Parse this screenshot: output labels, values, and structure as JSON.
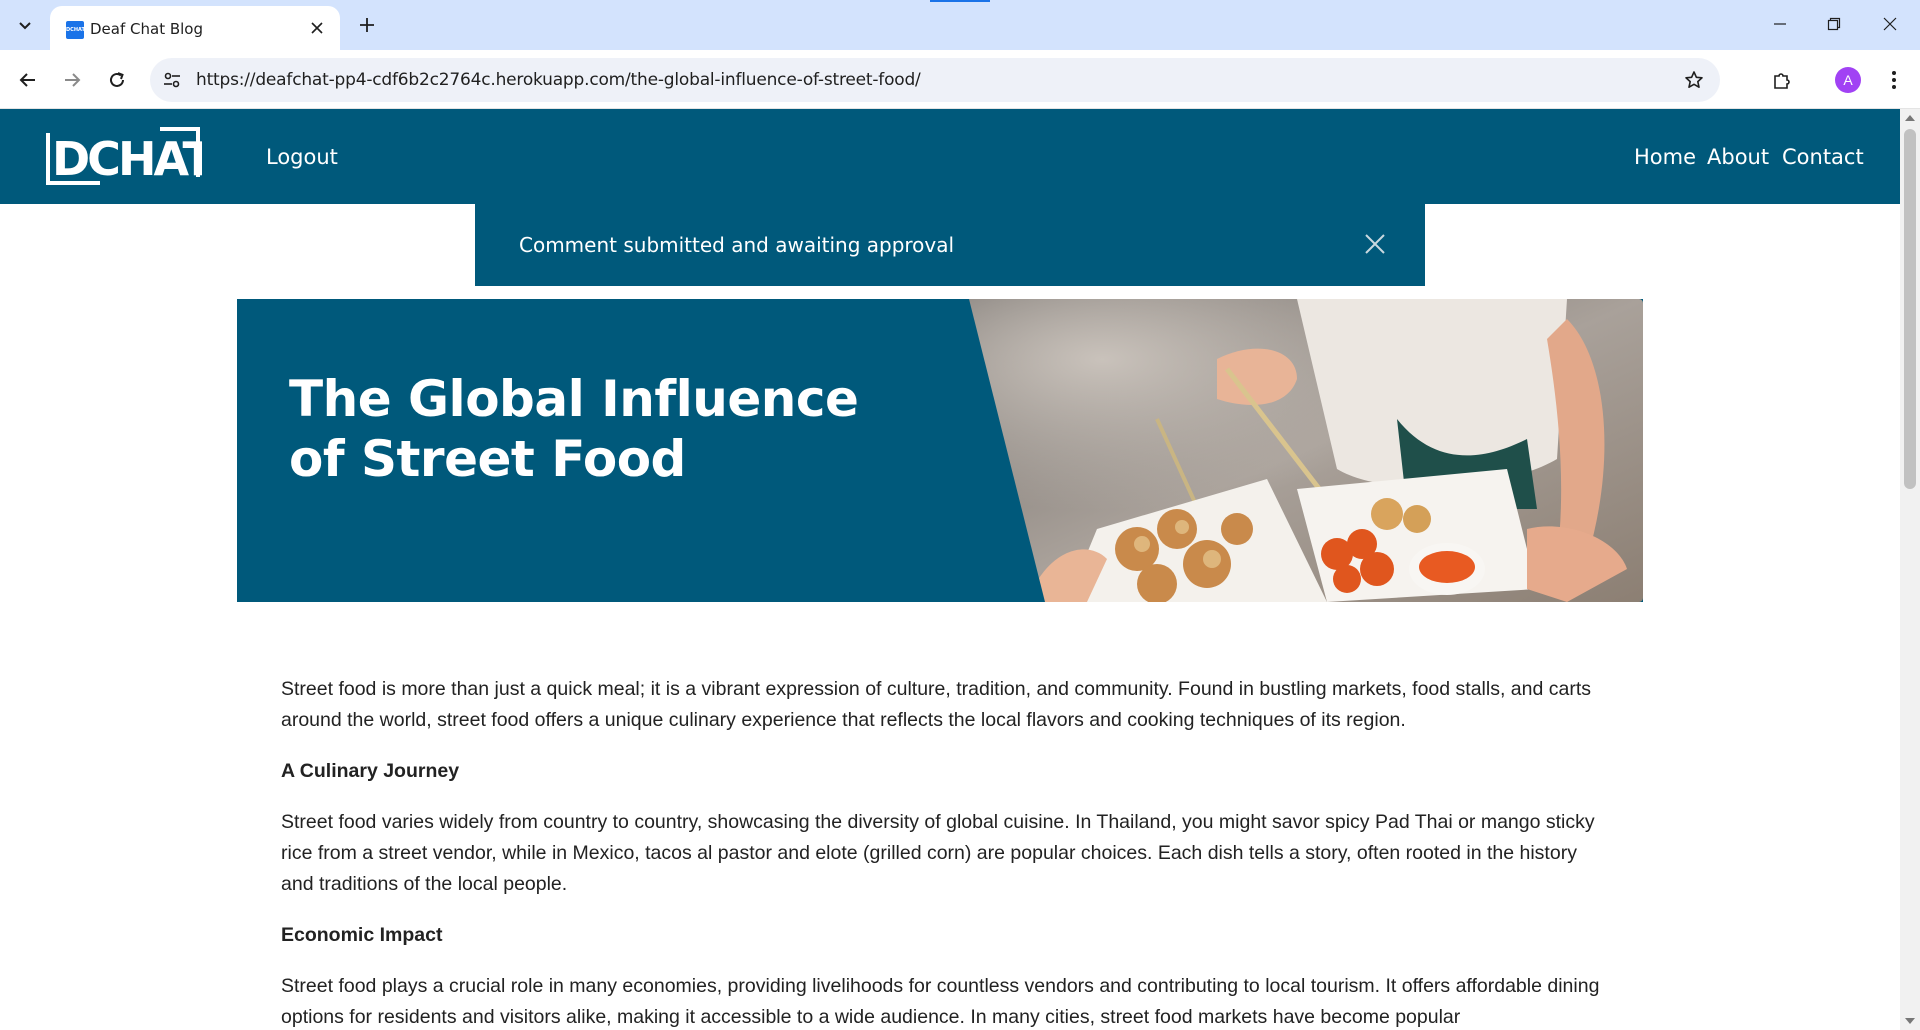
{
  "browser": {
    "tab_title": "Deaf Chat Blog",
    "favicon_text": "DCHAT",
    "url": "https://deafchat-pp4-cdf6b2c2764c.herokuapp.com/the-global-influence-of-street-food/",
    "profile_initial": "A"
  },
  "site": {
    "logo_text": "DCHAT",
    "logout": "Logout",
    "nav": {
      "home": "Home",
      "about": "About",
      "contact": "Contact"
    },
    "colors": {
      "primary": "#00597b"
    }
  },
  "alert": {
    "message": "Comment submitted and awaiting approval"
  },
  "post": {
    "title": "The Global Influence of Street Food",
    "paragraphs": [
      "Street food is more than just a quick meal; it is a vibrant expression of culture, tradition, and community. Found in bustling markets, food stalls, and carts around the world, street food offers a unique culinary experience that reflects the local flavors and cooking techniques of its region."
    ],
    "sections": [
      {
        "heading": "A Culinary Journey",
        "text": "Street food varies widely from country to country, showcasing the diversity of global cuisine. In Thailand, you might savor spicy Pad Thai or mango sticky rice from a street vendor, while in Mexico, tacos al pastor and elote (grilled corn) are popular choices. Each dish tells a story, often rooted in the history and traditions of the local people."
      },
      {
        "heading": "Economic Impact",
        "text": "Street food plays a crucial role in many economies, providing livelihoods for countless vendors and contributing to local tourism. It offers affordable dining options for residents and visitors alike, making it accessible to a wide audience. In many cities, street food markets have become popular"
      }
    ]
  }
}
